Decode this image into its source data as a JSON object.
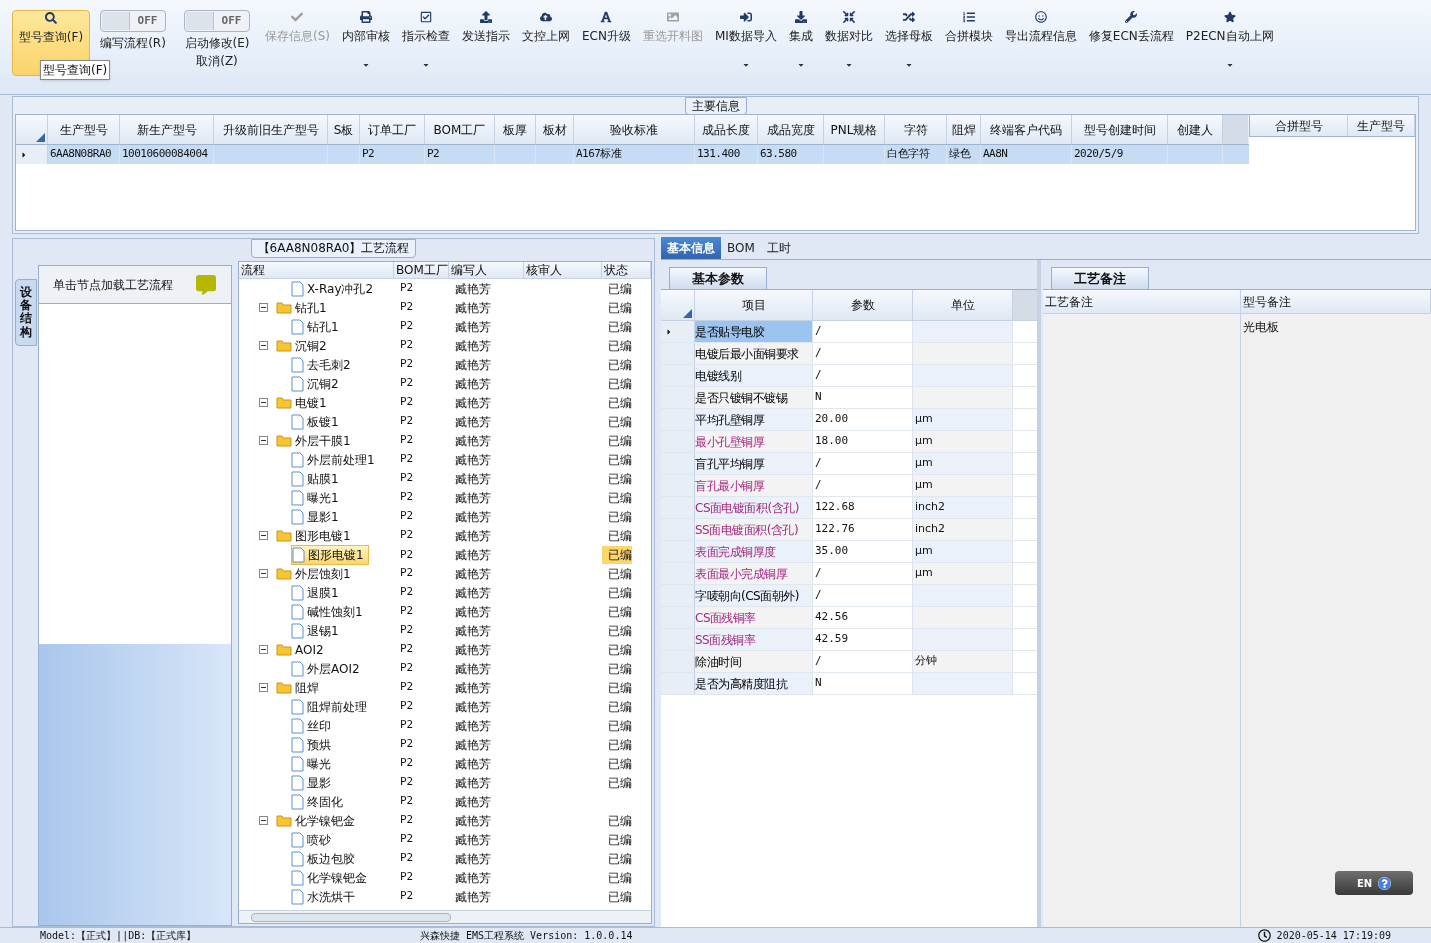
{
  "toolbar": {
    "items": [
      {
        "kind": "button",
        "label": "型号查询(F)",
        "selected": true,
        "disabled": false,
        "menu": false
      },
      {
        "kind": "toggle",
        "state": "OFF",
        "on": false,
        "label": "编写流程(R)"
      },
      {
        "kind": "toggle",
        "state": "OFF",
        "on": false,
        "label": "启动修改(E)",
        "sublabel": "取消(Z)"
      },
      {
        "kind": "button",
        "label": "保存信息(S)",
        "selected": false,
        "disabled": true,
        "menu": false
      },
      {
        "kind": "button",
        "label": "内部审核",
        "selected": false,
        "disabled": false,
        "menu": true
      },
      {
        "kind": "button",
        "label": "指示检查",
        "selected": false,
        "disabled": false,
        "menu": true
      },
      {
        "kind": "button",
        "label": "发送指示",
        "selected": false,
        "disabled": false,
        "menu": false
      },
      {
        "kind": "button",
        "label": "文控上网",
        "selected": false,
        "disabled": false,
        "menu": false
      },
      {
        "kind": "button",
        "label": "ECN升级",
        "selected": false,
        "disabled": false,
        "menu": false
      },
      {
        "kind": "button",
        "label": "重选开料图",
        "selected": false,
        "disabled": true,
        "menu": false
      },
      {
        "kind": "button",
        "label": "MI数据导入",
        "selected": false,
        "disabled": false,
        "menu": true
      },
      {
        "kind": "button",
        "label": "集成",
        "selected": false,
        "disabled": false,
        "menu": true
      },
      {
        "kind": "button",
        "label": "数据对比",
        "selected": false,
        "disabled": false,
        "menu": true
      },
      {
        "kind": "button",
        "label": "选择母板",
        "selected": false,
        "disabled": false,
        "menu": true
      },
      {
        "kind": "button",
        "label": "合拼模块",
        "selected": false,
        "disabled": false,
        "menu": false
      },
      {
        "kind": "button",
        "label": "导出流程信息",
        "selected": false,
        "disabled": false,
        "menu": false
      },
      {
        "kind": "button",
        "label": "修复ECN丢流程",
        "selected": false,
        "disabled": false,
        "menu": false
      },
      {
        "kind": "button",
        "label": "P2ECN自动上网",
        "selected": false,
        "disabled": false,
        "menu": true
      }
    ],
    "tooltip": "型号查询(F)"
  },
  "main_info": {
    "title": "主要信息",
    "columns": [
      "生产型号",
      "新生产型号",
      "升级前旧生产型号",
      "S板",
      "订单工厂",
      "BOM工厂",
      "板厚",
      "板材",
      "验收标准",
      "成品长度",
      "成品宽度",
      "PNL规格",
      "字符",
      "阻焊",
      "终端客户代码",
      "型号创建时间",
      "创建人"
    ],
    "rows": [
      {
        "selected": true,
        "cells": [
          "6AA8N08RA0",
          "10010600084004",
          null,
          null,
          "P2",
          "P2",
          null,
          null,
          "A167标准",
          "131.400",
          "63.580",
          null,
          "白色字符",
          "绿色",
          "AA8N",
          "2020/5/9",
          null
        ]
      }
    ],
    "side_columns": [
      "合拼型号",
      "生产型号"
    ]
  },
  "process": {
    "title": "【6AA8N08RA0】工艺流程",
    "side_tab": "设备结构",
    "hint": "单击节点加载工艺流程",
    "columns": [
      "流程",
      "BOM工厂",
      "编写人",
      "核审人",
      "状态"
    ],
    "tree": [
      {
        "kind": "file",
        "name": "X-Ray冲孔2",
        "bom": "P2",
        "author": "臧艳芳",
        "status": "已编",
        "selected": false
      },
      {
        "kind": "folder",
        "name": "钻孔1",
        "bom": "P2",
        "author": "臧艳芳",
        "status": "已编",
        "selected": false,
        "expanded": true,
        "children": [
          {
            "kind": "file",
            "name": "钻孔1",
            "bom": "P2",
            "author": "臧艳芳",
            "status": "已编",
            "selected": false
          }
        ]
      },
      {
        "kind": "folder",
        "name": "沉铜2",
        "bom": "P2",
        "author": "臧艳芳",
        "status": "已编",
        "selected": false,
        "expanded": true,
        "children": [
          {
            "kind": "file",
            "name": "去毛刺2",
            "bom": "P2",
            "author": "臧艳芳",
            "status": "已编",
            "selected": false
          },
          {
            "kind": "file",
            "name": "沉铜2",
            "bom": "P2",
            "author": "臧艳芳",
            "status": "已编",
            "selected": false
          }
        ]
      },
      {
        "kind": "folder",
        "name": "电镀1",
        "bom": "P2",
        "author": "臧艳芳",
        "status": "已编",
        "selected": false,
        "expanded": true,
        "children": [
          {
            "kind": "file",
            "name": "板镀1",
            "bom": "P2",
            "author": "臧艳芳",
            "status": "已编",
            "selected": false
          }
        ]
      },
      {
        "kind": "folder",
        "name": "外层干膜1",
        "bom": "P2",
        "author": "臧艳芳",
        "status": "已编",
        "selected": false,
        "expanded": true,
        "children": [
          {
            "kind": "file",
            "name": "外层前处理1",
            "bom": "P2",
            "author": "臧艳芳",
            "status": "已编",
            "selected": false
          },
          {
            "kind": "file",
            "name": "贴膜1",
            "bom": "P2",
            "author": "臧艳芳",
            "status": "已编",
            "selected": false
          },
          {
            "kind": "file",
            "name": "曝光1",
            "bom": "P2",
            "author": "臧艳芳",
            "status": "已编",
            "selected": false
          },
          {
            "kind": "file",
            "name": "显影1",
            "bom": "P2",
            "author": "臧艳芳",
            "status": "已编",
            "selected": false
          }
        ]
      },
      {
        "kind": "folder",
        "name": "图形电镀1",
        "bom": "P2",
        "author": "臧艳芳",
        "status": "已编",
        "selected": false,
        "expanded": true,
        "children": [
          {
            "kind": "file",
            "name": "图形电镀1",
            "bom": "P2",
            "author": "臧艳芳",
            "status": "已编",
            "selected": true
          }
        ]
      },
      {
        "kind": "folder",
        "name": "外层蚀刻1",
        "bom": "P2",
        "author": "臧艳芳",
        "status": "已编",
        "selected": false,
        "expanded": true,
        "children": [
          {
            "kind": "file",
            "name": "退膜1",
            "bom": "P2",
            "author": "臧艳芳",
            "status": "已编",
            "selected": false
          },
          {
            "kind": "file",
            "name": "碱性蚀刻1",
            "bom": "P2",
            "author": "臧艳芳",
            "status": "已编",
            "selected": false
          },
          {
            "kind": "file",
            "name": "退锡1",
            "bom": "P2",
            "author": "臧艳芳",
            "status": "已编",
            "selected": false
          }
        ]
      },
      {
        "kind": "folder",
        "name": "AOI2",
        "bom": "P2",
        "author": "臧艳芳",
        "status": "已编",
        "selected": false,
        "expanded": true,
        "children": [
          {
            "kind": "file",
            "name": "外层AOI2",
            "bom": "P2",
            "author": "臧艳芳",
            "status": "已编",
            "selected": false
          }
        ]
      },
      {
        "kind": "folder",
        "name": "阻焊",
        "bom": "P2",
        "author": "臧艳芳",
        "status": "已编",
        "selected": false,
        "expanded": true,
        "children": [
          {
            "kind": "file",
            "name": "阻焊前处理",
            "bom": "P2",
            "author": "臧艳芳",
            "status": "已编",
            "selected": false
          },
          {
            "kind": "file",
            "name": "丝印",
            "bom": "P2",
            "author": "臧艳芳",
            "status": "已编",
            "selected": false
          },
          {
            "kind": "file",
            "name": "预烘",
            "bom": "P2",
            "author": "臧艳芳",
            "status": "已编",
            "selected": false
          },
          {
            "kind": "file",
            "name": "曝光",
            "bom": "P2",
            "author": "臧艳芳",
            "status": "已编",
            "selected": false
          },
          {
            "kind": "file",
            "name": "显影",
            "bom": "P2",
            "author": "臧艳芳",
            "status": "已编",
            "selected": false
          },
          {
            "kind": "file",
            "name": "终固化",
            "bom": "P2",
            "author": "臧艳芳",
            "selected": false
          }
        ]
      },
      {
        "kind": "folder",
        "name": "化学镍钯金",
        "bom": "P2",
        "author": "臧艳芳",
        "status": "已编",
        "selected": false,
        "expanded": true,
        "children": [
          {
            "kind": "file",
            "name": "喷砂",
            "bom": "P2",
            "author": "臧艳芳",
            "status": "已编",
            "selected": false
          },
          {
            "kind": "file",
            "name": "板边包胶",
            "bom": "P2",
            "author": "臧艳芳",
            "status": "已编",
            "selected": false
          },
          {
            "kind": "file",
            "name": "化学镍钯金",
            "bom": "P2",
            "author": "臧艳芳",
            "status": "已编",
            "selected": false
          },
          {
            "kind": "file",
            "name": "水洗烘干",
            "bom": "P2",
            "author": "臧艳芳",
            "status": "已编",
            "selected": false
          }
        ]
      }
    ]
  },
  "detail": {
    "tabs": [
      {
        "label": "基本信息",
        "selected": true
      },
      {
        "label": "BOM",
        "selected": false
      },
      {
        "label": "工时",
        "selected": false
      }
    ],
    "params_tab": "基本参数",
    "columns": [
      "项目",
      "参数",
      "单位"
    ],
    "params": [
      {
        "item": "是否贴导电胶",
        "value": "/",
        "emphasis": false,
        "selected": true
      },
      {
        "item": "电镀后最小面铜要求",
        "value": "/",
        "emphasis": false,
        "selected": false
      },
      {
        "item": "电镀线别",
        "value": "/",
        "emphasis": false,
        "selected": false
      },
      {
        "item": "是否只镀铜不镀锡",
        "value": "N",
        "emphasis": false,
        "selected": false
      },
      {
        "item": "平均孔壁铜厚",
        "value": "20.00",
        "unit": "μm",
        "emphasis": false,
        "selected": false
      },
      {
        "item": "最小孔壁铜厚",
        "value": "18.00",
        "unit": "μm",
        "emphasis": true,
        "selected": false
      },
      {
        "item": "盲孔平均铜厚",
        "value": "/",
        "unit": "μm",
        "emphasis": false,
        "selected": false
      },
      {
        "item": "盲孔最小铜厚",
        "value": "/",
        "unit": "μm",
        "emphasis": true,
        "selected": false
      },
      {
        "item": "CS面电镀面积(含孔)",
        "value": "122.68",
        "unit": "inch2",
        "emphasis": true,
        "selected": false
      },
      {
        "item": "SS面电镀面积(含孔)",
        "value": "122.76",
        "unit": "inch2",
        "emphasis": true,
        "selected": false
      },
      {
        "item": "表面完成铜厚度",
        "value": "35.00",
        "unit": "μm",
        "emphasis": true,
        "selected": false
      },
      {
        "item": "表面最小完成铜厚",
        "value": "/",
        "unit": "μm",
        "emphasis": true,
        "selected": false
      },
      {
        "item": "字唛朝向(CS面朝外)",
        "value": "/",
        "emphasis": false,
        "selected": false
      },
      {
        "item": "CS面残铜率",
        "value": "42.56",
        "emphasis": true,
        "selected": false
      },
      {
        "item": "SS面残铜率",
        "value": "42.59",
        "emphasis": true,
        "selected": false
      },
      {
        "item": "除油时间",
        "value": "/",
        "unit": "分钟",
        "emphasis": false,
        "selected": false
      },
      {
        "item": "是否为高精度阻抗",
        "value": "N",
        "emphasis": false,
        "selected": false
      }
    ],
    "notes_tab": "工艺备注",
    "notes_columns": [
      "工艺备注",
      "型号备注"
    ],
    "model_note": "光电板"
  },
  "language_bar": {
    "language": "EN"
  },
  "status_bar": {
    "left": "Model:【正式】||DB:【正式库】",
    "center": "兴森快捷 EMS工程系统 Version: 1.0.0.14",
    "time": "2020-05-14 17:19:09"
  }
}
